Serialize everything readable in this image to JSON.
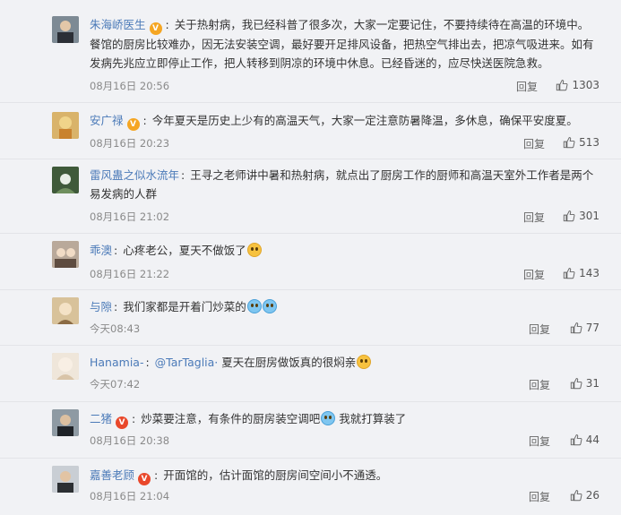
{
  "labels": {
    "reply": "回复"
  },
  "comments": [
    {
      "name": "朱海峤医生",
      "badge": "V",
      "text": "关于热射病，我已经科普了很多次，大家一定要记住，不要持续待在高温的环境中。餐馆的厨房比较难办，因无法安装空调，最好要开足排风设备，把热空气排出去，把凉气吸进来。如有发病先兆应立即停止工作，把人转移到阴凉的环境中休息。已经昏迷的，应尽快送医院急救。",
      "time": "08月16日 20:56",
      "likes": "1303"
    },
    {
      "name": "安广禄",
      "badge": "V",
      "text": "今年夏天是历史上少有的高温天气，大家一定注意防暑降温，多休息，确保平安度夏。",
      "time": "08月16日 20:23",
      "likes": "513"
    },
    {
      "name": "雷风蛊之似水流年",
      "text": "王寻之老师讲中暑和热射病，就点出了厨房工作的厨师和高温天室外工作者是两个易发病的人群",
      "time": "08月16日 21:02",
      "likes": "301"
    },
    {
      "name": "乖澳",
      "text": "心疼老公，夏天不做饭了",
      "time": "08月16日 21:22",
      "likes": "143"
    },
    {
      "name": "与隙",
      "text": "我们家都是开着门炒菜的",
      "time": "今天08:43",
      "likes": "77"
    },
    {
      "name": "Hanamia-",
      "mention": "@TarTaglia·",
      "text": "夏天在厨房做饭真的很焖亲",
      "time": "今天07:42",
      "likes": "31"
    },
    {
      "name": "二猪",
      "badge": "V",
      "text": "炒菜要注意，有条件的厨房装空调吧",
      "text_after": "我就打算装了",
      "time": "08月16日 20:38",
      "likes": "44"
    },
    {
      "name": "嘉善老顾",
      "badge": "V",
      "text": "开面馆的，估计面馆的厨房间空间小不通透。",
      "time": "08月16日 21:04",
      "likes": "26"
    }
  ],
  "colors": {
    "link": "#4b7ab8",
    "badge_gold": "#f5a623",
    "badge_red": "#e9482b"
  },
  "icons": {
    "like": "thumbs-up-icon"
  }
}
